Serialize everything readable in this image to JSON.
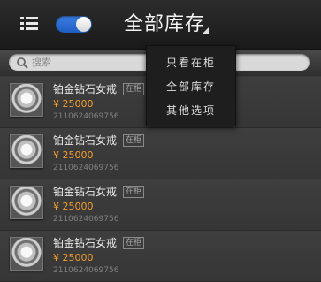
{
  "header": {
    "title": "全部库存",
    "menu_icon": "list-icon",
    "toggle_state": "on",
    "toggle_color": "#2f6fd6"
  },
  "search": {
    "placeholder": "搜索",
    "icon": "search-icon"
  },
  "items": [
    {
      "name": "铂金钻石女戒",
      "badge": "在柜",
      "price": "¥ 25000",
      "sku": "2110624069756"
    },
    {
      "name": "铂金钻石女戒",
      "badge": "在柜",
      "price": "¥ 25000",
      "sku": "2110624069756"
    },
    {
      "name": "铂金钻石女戒",
      "badge": "在柜",
      "price": "¥ 25000",
      "sku": "2110624069756"
    },
    {
      "name": "铂金钻石女戒",
      "badge": "在柜",
      "price": "¥ 25000",
      "sku": "2110624069756"
    }
  ],
  "dropdown": {
    "options": [
      "只看在柜",
      "全部库存",
      "其他选项"
    ]
  },
  "colors": {
    "price": "#f29e2c",
    "background": "#3a3a3a",
    "topbar": "#1f1f1f"
  }
}
